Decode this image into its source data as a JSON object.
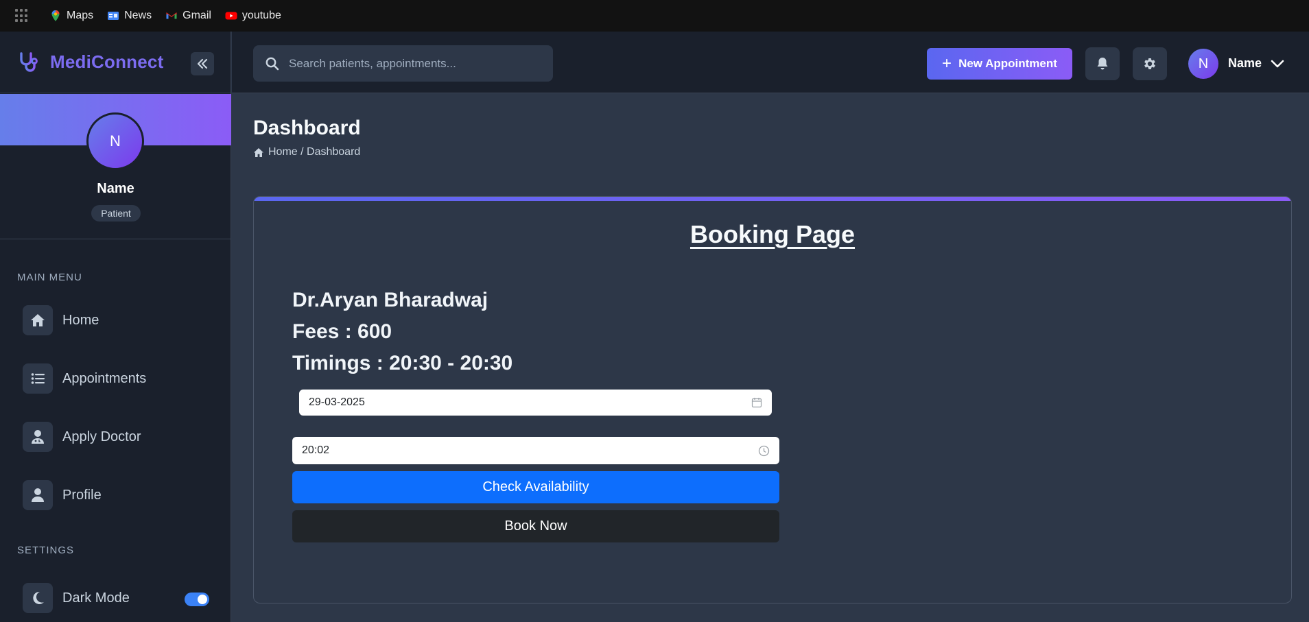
{
  "bookmarks": [
    {
      "label": "Maps",
      "icon": "maps-pin-icon"
    },
    {
      "label": "News",
      "icon": "google-news-icon"
    },
    {
      "label": "Gmail",
      "icon": "gmail-icon"
    },
    {
      "label": "youtube",
      "icon": "youtube-icon"
    }
  ],
  "brand": {
    "name": "MediConnect",
    "icon": "stethoscope-icon"
  },
  "profile": {
    "initial": "N",
    "name": "Name",
    "role": "Patient"
  },
  "sidebar": {
    "main_menu_label": "MAIN MENU",
    "settings_label": "SETTINGS",
    "items": [
      {
        "label": "Home",
        "icon": "home-icon"
      },
      {
        "label": "Appointments",
        "icon": "list-icon"
      },
      {
        "label": "Apply Doctor",
        "icon": "doctor-icon"
      },
      {
        "label": "Profile",
        "icon": "user-icon"
      }
    ],
    "dark_mode": {
      "label": "Dark Mode",
      "icon": "moon-icon",
      "enabled": true
    }
  },
  "header": {
    "search_placeholder": "Search patients, appointments...",
    "new_appointment_label": "New Appointment",
    "user_initial": "N",
    "user_name": "Name"
  },
  "page": {
    "title": "Dashboard",
    "breadcrumb": "Home / Dashboard"
  },
  "booking": {
    "title": "Booking Page",
    "doctor": "Dr.Aryan Bharadwaj",
    "fees": "Fees : 600",
    "timings": "Timings : 20:30 - 20:30",
    "date_value": "29-03-2025",
    "time_value": "20:02",
    "check_label": "Check Availability",
    "book_label": "Book Now"
  },
  "colors": {
    "accent": "#667eea",
    "accent2": "#8b5cf6",
    "primary_button": "#0d6efd",
    "dark_button": "#212529"
  }
}
